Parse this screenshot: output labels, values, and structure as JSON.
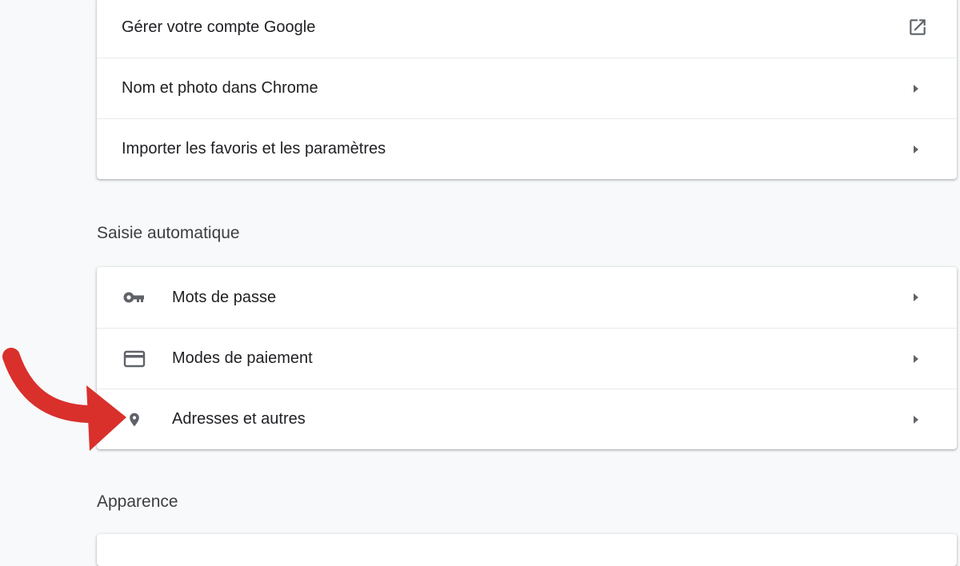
{
  "account": {
    "items": [
      {
        "label": "Gérer votre compte Google",
        "icon": "open-in-new-icon"
      },
      {
        "label": "Nom et photo dans Chrome",
        "icon": "chevron-right-icon"
      },
      {
        "label": "Importer les favoris et les paramètres",
        "icon": "chevron-right-icon"
      }
    ]
  },
  "autofill": {
    "title": "Saisie automatique",
    "items": [
      {
        "label": "Mots de passe",
        "icon": "key-icon"
      },
      {
        "label": "Modes de paiement",
        "icon": "credit-card-icon"
      },
      {
        "label": "Adresses et autres",
        "icon": "location-pin-icon"
      }
    ]
  },
  "appearance": {
    "title": "Apparence"
  },
  "colors": {
    "background": "#f8f9fa",
    "card": "#ffffff",
    "text": "#202124",
    "icon": "#5f6368",
    "annotation_arrow": "#d9302c"
  }
}
